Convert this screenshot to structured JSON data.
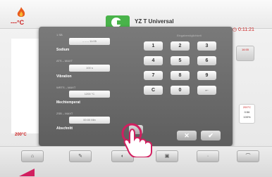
{
  "header": {
    "app_title": "YZ T Universal",
    "temperature": "---°C",
    "timer": "◷ 0:11:21"
  },
  "form": {
    "fields": [
      {
        "title": "1 SB",
        "label": "Sodium",
        "value": "– – – 11:05"
      },
      {
        "title": "ATS – MAXT",
        "label": "Vibration",
        "value": "100 s"
      },
      {
        "title": "WRTS – MAXT",
        "label": "Mechtemperat",
        "value": "1200 °C"
      },
      {
        "title": "ZSB – MAXT",
        "label": "Abschnitt",
        "value": "00:00 Min"
      }
    ]
  },
  "keypad": {
    "header": "Eingabemöglichkeit",
    "rows": [
      [
        "1",
        "2",
        "3"
      ],
      [
        "4",
        "5",
        "6"
      ],
      [
        "7",
        "8",
        "9"
      ],
      [
        "C",
        "0",
        "←"
      ]
    ],
    "cancel_label": "✕",
    "confirm_label": "✔"
  },
  "side": {
    "temperature": "200°C",
    "right_top": "16:55",
    "right_prog": [
      "200°C",
      "0:56",
      "100%"
    ]
  },
  "bottom_bar": {
    "buttons": [
      "",
      "",
      "",
      "",
      "",
      ""
    ]
  },
  "colors": {
    "accent_green": "#49b34a",
    "accent_red": "#cc2222",
    "marker_pink": "#d11f5f"
  }
}
